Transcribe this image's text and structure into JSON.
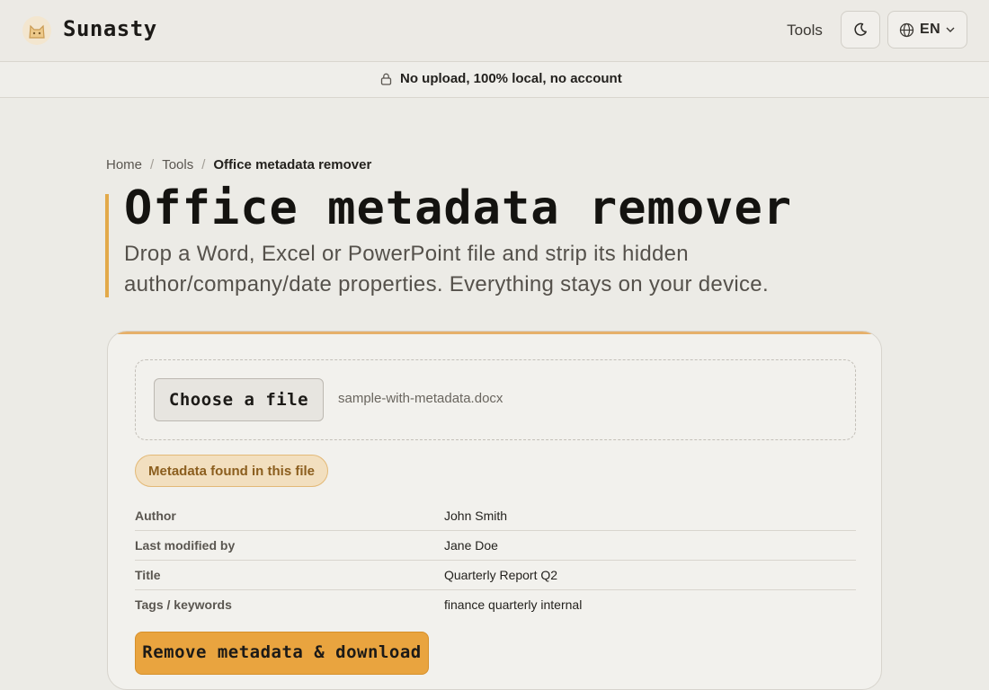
{
  "header": {
    "brand": "Sunasty",
    "logo_icon": "cat-logo-icon",
    "nav_tools": "Tools",
    "theme_icon": "moon-icon",
    "language_label": "EN",
    "language_icon": "globe-icon"
  },
  "banner": {
    "icon": "lock-icon",
    "text": "No upload, 100% local, no account"
  },
  "breadcrumb": {
    "home": "Home",
    "sep": "/",
    "tools": "Tools",
    "current": "Office metadata remover"
  },
  "page": {
    "title": "Office metadata remover",
    "subtitle": "Drop a Word, Excel or PowerPoint file and strip its hidden author/company/date properties. Everything stays on your device."
  },
  "upload": {
    "choose_label": "Choose a file",
    "file_name": "sample-with-metadata.docx"
  },
  "metadata": {
    "badge": "Metadata found in this file",
    "rows": [
      {
        "key": "Author",
        "value": "John Smith"
      },
      {
        "key": "Last modified by",
        "value": "Jane Doe"
      },
      {
        "key": "Title",
        "value": "Quarterly Report Q2"
      },
      {
        "key": "Tags / keywords",
        "value": "finance quarterly internal"
      }
    ]
  },
  "actions": {
    "remove_label": "Remove metadata & download"
  },
  "colors": {
    "accent": "#e9a43f",
    "background": "#ecebe6",
    "badge_bg": "#f2dfbf"
  }
}
